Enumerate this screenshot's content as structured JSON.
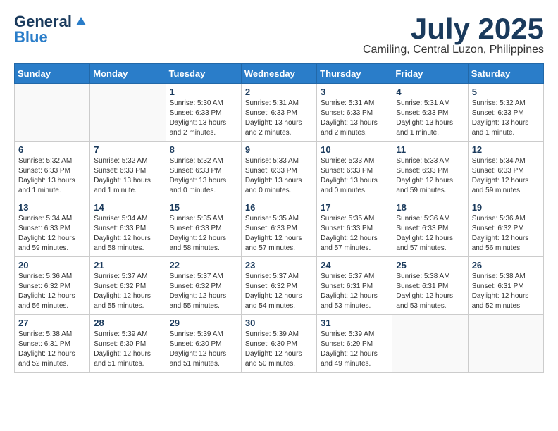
{
  "header": {
    "logo_line1": "General",
    "logo_line2": "Blue",
    "month_title": "July 2025",
    "location": "Camiling, Central Luzon, Philippines"
  },
  "weekdays": [
    "Sunday",
    "Monday",
    "Tuesday",
    "Wednesday",
    "Thursday",
    "Friday",
    "Saturday"
  ],
  "weeks": [
    [
      {
        "day": "",
        "info": ""
      },
      {
        "day": "",
        "info": ""
      },
      {
        "day": "1",
        "info": "Sunrise: 5:30 AM\nSunset: 6:33 PM\nDaylight: 13 hours and 2 minutes."
      },
      {
        "day": "2",
        "info": "Sunrise: 5:31 AM\nSunset: 6:33 PM\nDaylight: 13 hours and 2 minutes."
      },
      {
        "day": "3",
        "info": "Sunrise: 5:31 AM\nSunset: 6:33 PM\nDaylight: 13 hours and 2 minutes."
      },
      {
        "day": "4",
        "info": "Sunrise: 5:31 AM\nSunset: 6:33 PM\nDaylight: 13 hours and 1 minute."
      },
      {
        "day": "5",
        "info": "Sunrise: 5:32 AM\nSunset: 6:33 PM\nDaylight: 13 hours and 1 minute."
      }
    ],
    [
      {
        "day": "6",
        "info": "Sunrise: 5:32 AM\nSunset: 6:33 PM\nDaylight: 13 hours and 1 minute."
      },
      {
        "day": "7",
        "info": "Sunrise: 5:32 AM\nSunset: 6:33 PM\nDaylight: 13 hours and 1 minute."
      },
      {
        "day": "8",
        "info": "Sunrise: 5:32 AM\nSunset: 6:33 PM\nDaylight: 13 hours and 0 minutes."
      },
      {
        "day": "9",
        "info": "Sunrise: 5:33 AM\nSunset: 6:33 PM\nDaylight: 13 hours and 0 minutes."
      },
      {
        "day": "10",
        "info": "Sunrise: 5:33 AM\nSunset: 6:33 PM\nDaylight: 13 hours and 0 minutes."
      },
      {
        "day": "11",
        "info": "Sunrise: 5:33 AM\nSunset: 6:33 PM\nDaylight: 12 hours and 59 minutes."
      },
      {
        "day": "12",
        "info": "Sunrise: 5:34 AM\nSunset: 6:33 PM\nDaylight: 12 hours and 59 minutes."
      }
    ],
    [
      {
        "day": "13",
        "info": "Sunrise: 5:34 AM\nSunset: 6:33 PM\nDaylight: 12 hours and 59 minutes."
      },
      {
        "day": "14",
        "info": "Sunrise: 5:34 AM\nSunset: 6:33 PM\nDaylight: 12 hours and 58 minutes."
      },
      {
        "day": "15",
        "info": "Sunrise: 5:35 AM\nSunset: 6:33 PM\nDaylight: 12 hours and 58 minutes."
      },
      {
        "day": "16",
        "info": "Sunrise: 5:35 AM\nSunset: 6:33 PM\nDaylight: 12 hours and 57 minutes."
      },
      {
        "day": "17",
        "info": "Sunrise: 5:35 AM\nSunset: 6:33 PM\nDaylight: 12 hours and 57 minutes."
      },
      {
        "day": "18",
        "info": "Sunrise: 5:36 AM\nSunset: 6:33 PM\nDaylight: 12 hours and 57 minutes."
      },
      {
        "day": "19",
        "info": "Sunrise: 5:36 AM\nSunset: 6:32 PM\nDaylight: 12 hours and 56 minutes."
      }
    ],
    [
      {
        "day": "20",
        "info": "Sunrise: 5:36 AM\nSunset: 6:32 PM\nDaylight: 12 hours and 56 minutes."
      },
      {
        "day": "21",
        "info": "Sunrise: 5:37 AM\nSunset: 6:32 PM\nDaylight: 12 hours and 55 minutes."
      },
      {
        "day": "22",
        "info": "Sunrise: 5:37 AM\nSunset: 6:32 PM\nDaylight: 12 hours and 55 minutes."
      },
      {
        "day": "23",
        "info": "Sunrise: 5:37 AM\nSunset: 6:32 PM\nDaylight: 12 hours and 54 minutes."
      },
      {
        "day": "24",
        "info": "Sunrise: 5:37 AM\nSunset: 6:31 PM\nDaylight: 12 hours and 53 minutes."
      },
      {
        "day": "25",
        "info": "Sunrise: 5:38 AM\nSunset: 6:31 PM\nDaylight: 12 hours and 53 minutes."
      },
      {
        "day": "26",
        "info": "Sunrise: 5:38 AM\nSunset: 6:31 PM\nDaylight: 12 hours and 52 minutes."
      }
    ],
    [
      {
        "day": "27",
        "info": "Sunrise: 5:38 AM\nSunset: 6:31 PM\nDaylight: 12 hours and 52 minutes."
      },
      {
        "day": "28",
        "info": "Sunrise: 5:39 AM\nSunset: 6:30 PM\nDaylight: 12 hours and 51 minutes."
      },
      {
        "day": "29",
        "info": "Sunrise: 5:39 AM\nSunset: 6:30 PM\nDaylight: 12 hours and 51 minutes."
      },
      {
        "day": "30",
        "info": "Sunrise: 5:39 AM\nSunset: 6:30 PM\nDaylight: 12 hours and 50 minutes."
      },
      {
        "day": "31",
        "info": "Sunrise: 5:39 AM\nSunset: 6:29 PM\nDaylight: 12 hours and 49 minutes."
      },
      {
        "day": "",
        "info": ""
      },
      {
        "day": "",
        "info": ""
      }
    ]
  ]
}
